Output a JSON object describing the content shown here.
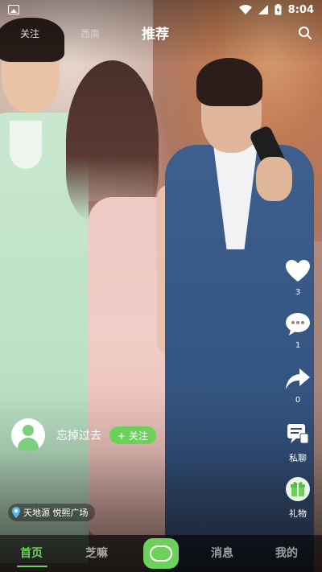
{
  "status_bar": {
    "time": "8:04",
    "icons": [
      "image-icon",
      "wifi-icon",
      "signal-icon",
      "battery-charging-icon"
    ]
  },
  "top_tabs": {
    "follow": "关注",
    "same_city": "西南",
    "recommend": "推荐",
    "search_icon": "search-icon"
  },
  "actions": {
    "like_count": "3",
    "comment_count": "1",
    "share_count": "0",
    "chat_label": "私聊",
    "gift_label": "礼物"
  },
  "author": {
    "name": "忘掉过去",
    "follow_label": "+ 关注"
  },
  "location": {
    "text": "天地源 悦熙广场"
  },
  "bottom_nav": {
    "home": "首页",
    "zhima": "芝嘛",
    "messages": "消息",
    "me": "我的"
  },
  "colors": {
    "accent": "#6cd15a",
    "like": "#ffffff"
  }
}
